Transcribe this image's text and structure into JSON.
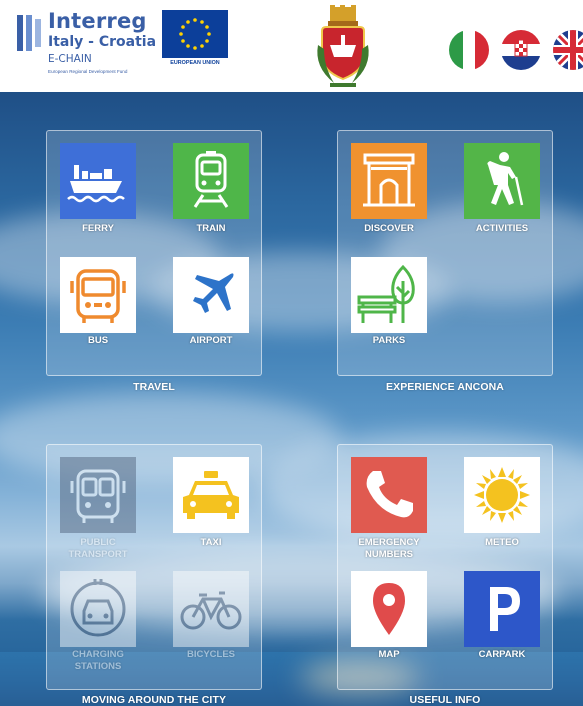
{
  "header": {
    "interreg_logo": {
      "brand": "Interreg",
      "program": "Italy - Croatia",
      "project": "E-CHAIN",
      "fund": "European Regional Development Fund"
    },
    "eu_label": "EUROPEAN UNION",
    "coat_of_arms_icon": "ancona-coat-of-arms-icon",
    "languages": [
      {
        "name": "italian-flag-icon",
        "colors": [
          "#2d9a47",
          "#ffffff",
          "#d62b36"
        ]
      },
      {
        "name": "croatian-flag-icon",
        "colors": [
          "#d62b36",
          "#ffffff",
          "#1e3e8f"
        ]
      },
      {
        "name": "uk-flag-icon",
        "colors": [
          "#1e3e8f",
          "#ffffff",
          "#d62b36"
        ]
      }
    ]
  },
  "sections": {
    "travel": {
      "title": "TRAVEL",
      "tiles": [
        {
          "label": "FERRY",
          "icon": "ferry-icon",
          "bg": "#3e6fd8"
        },
        {
          "label": "TRAIN",
          "icon": "train-icon",
          "bg": "#4fb649"
        },
        {
          "label": "BUS",
          "icon": "bus-icon",
          "bg": "#ffffff"
        },
        {
          "label": "AIRPORT",
          "icon": "airplane-icon",
          "bg": "#ffffff"
        }
      ]
    },
    "experience": {
      "title": "EXPERIENCE ANCONA",
      "tiles": [
        {
          "label": "DISCOVER",
          "icon": "arch-icon",
          "bg": "#f0922f"
        },
        {
          "label": "ACTIVITIES",
          "icon": "hiker-icon",
          "bg": "#53b548"
        },
        {
          "label": "PARKS",
          "icon": "park-icon",
          "bg": "#ffffff"
        }
      ]
    },
    "moving": {
      "title": "MOVING AROUND THE CITY",
      "tiles": [
        {
          "label": "PUBLIC TRANSPORT",
          "label_line1": "PUBLIC",
          "label_line2": "TRANSPORT",
          "icon": "public-transport-icon",
          "bg": "#4a5b75",
          "disabled": true
        },
        {
          "label": "TAXI",
          "icon": "taxi-icon",
          "bg": "#ffffff"
        },
        {
          "label": "CHARGING STATIONS",
          "label_line1": "CHARGING",
          "label_line2": "STATIONS",
          "icon": "charging-station-icon",
          "bg": "#ffffff",
          "disabled": true
        },
        {
          "label": "BICYCLES",
          "icon": "bicycle-icon",
          "bg": "#ffffff",
          "disabled": true
        }
      ]
    },
    "useful": {
      "title": "USEFUL INFO",
      "tiles": [
        {
          "label": "EMERGENCY NUMBERS",
          "label_line1": "EMERGENCY",
          "label_line2": "NUMBERS",
          "icon": "phone-icon",
          "bg": "#e05a50"
        },
        {
          "label": "METEO",
          "icon": "sun-icon",
          "bg": "#ffffff"
        },
        {
          "label": "MAP",
          "icon": "map-pin-icon",
          "bg": "#ffffff"
        },
        {
          "label": "CARPARK",
          "icon": "parking-icon",
          "bg": "#2d57c9"
        }
      ]
    }
  }
}
